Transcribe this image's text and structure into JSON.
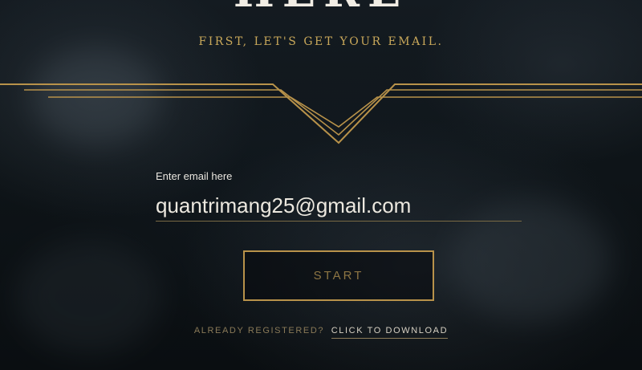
{
  "hero": {
    "title": "HERE",
    "subtitle": "FIRST, LET'S GET YOUR EMAIL."
  },
  "form": {
    "email_label": "Enter email here",
    "email_value": "quantrimang25@gmail.com",
    "start_label": "START"
  },
  "footer": {
    "prompt": "ALREADY REGISTERED?",
    "link_label": "CLICK TO DOWNLOAD"
  },
  "colors": {
    "gold": "#c9a85a",
    "gold_dim": "#8d7543",
    "text_light": "#ece8df",
    "background": "#0b0f13"
  },
  "icons": {
    "divider": "gold-chevron-divider"
  }
}
